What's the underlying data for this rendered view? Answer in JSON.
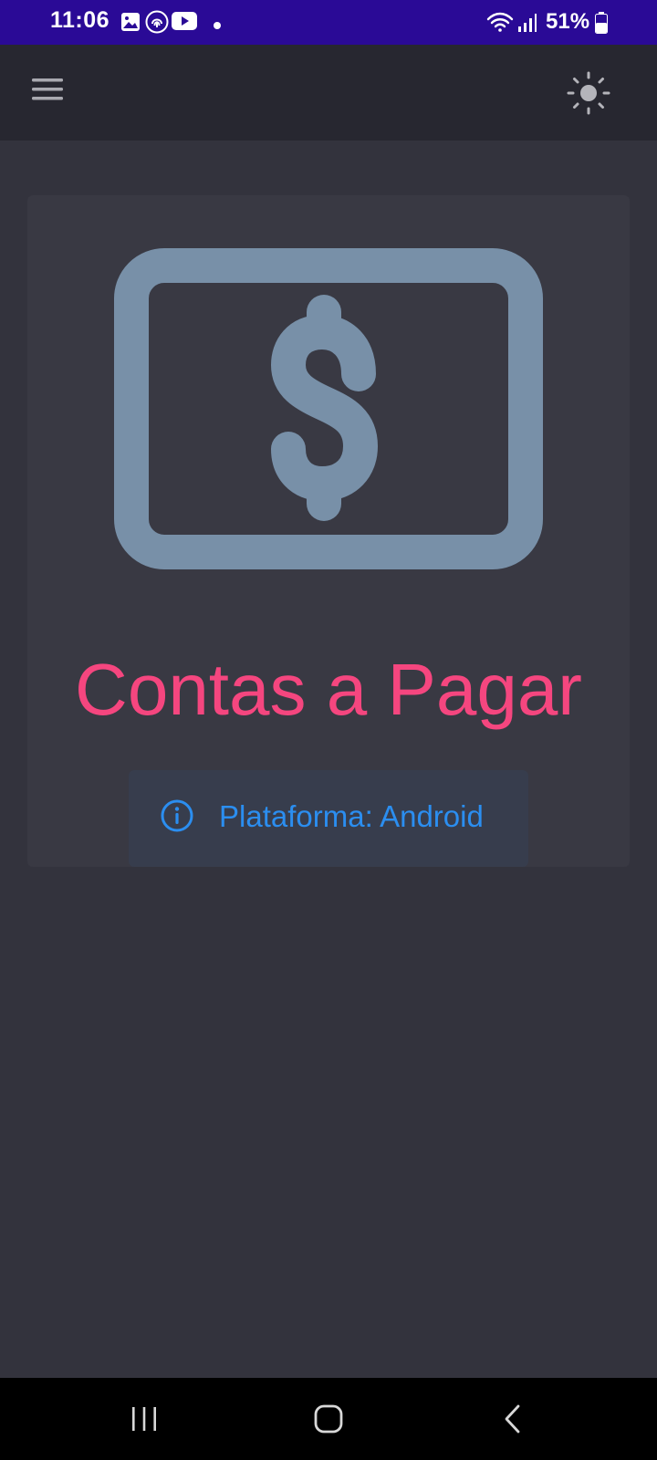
{
  "status_bar": {
    "time": "11:06",
    "battery": "51%",
    "icons": [
      "gallery-icon",
      "fingerprint-icon",
      "youtube-icon",
      "notification-dot-icon",
      "wifi-icon",
      "signal-icon",
      "battery-icon"
    ],
    "background": "#2a0a96"
  },
  "app_bar": {
    "menu_icon": "hamburger-menu-icon",
    "theme_icon": "sun-icon"
  },
  "card": {
    "icon": "money-bill-dollar-icon",
    "title": "Contas a Pagar",
    "info": {
      "icon": "info-circle-icon",
      "text": "Plataforma: Android"
    }
  },
  "colors": {
    "background": "#33333d",
    "app_bar": "#272730",
    "card": "#393943",
    "title": "#f5467f",
    "icon": "#7890a8",
    "info_bg": "#373d4d",
    "info_text": "#2b8ef0"
  },
  "nav_bar": {
    "buttons": [
      "recent-apps-icon",
      "home-icon",
      "back-icon"
    ]
  }
}
